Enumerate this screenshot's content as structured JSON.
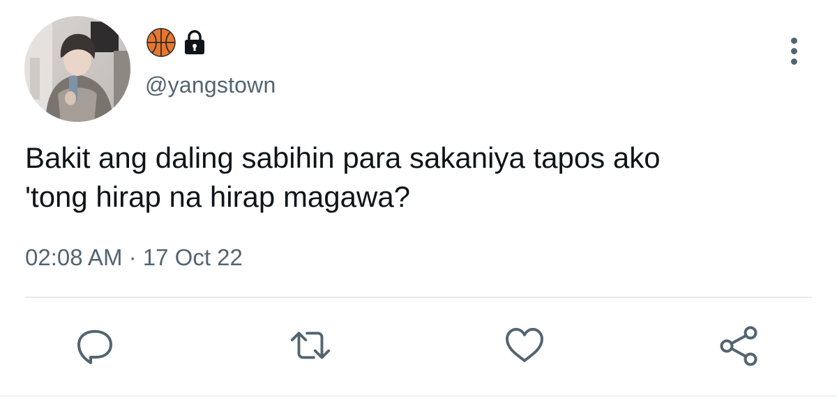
{
  "profile": {
    "name_emojis": [
      "basketball-emoji",
      "lock-icon"
    ],
    "handle": "@yangstown"
  },
  "tweet": {
    "text": "Bakit ang daling sabihin para sakaniya tapos ako\n'tong hirap na hirap magawa?",
    "time": "02:08 AM",
    "separator": "·",
    "date": "17 Oct 22"
  },
  "actions": [
    "reply-icon",
    "retweet-icon",
    "like-icon",
    "share-icon"
  ],
  "colors": {
    "text": "#0f1419",
    "secondary": "#536471",
    "divider": "#e6ecf0",
    "basketball": "#e8772e"
  }
}
